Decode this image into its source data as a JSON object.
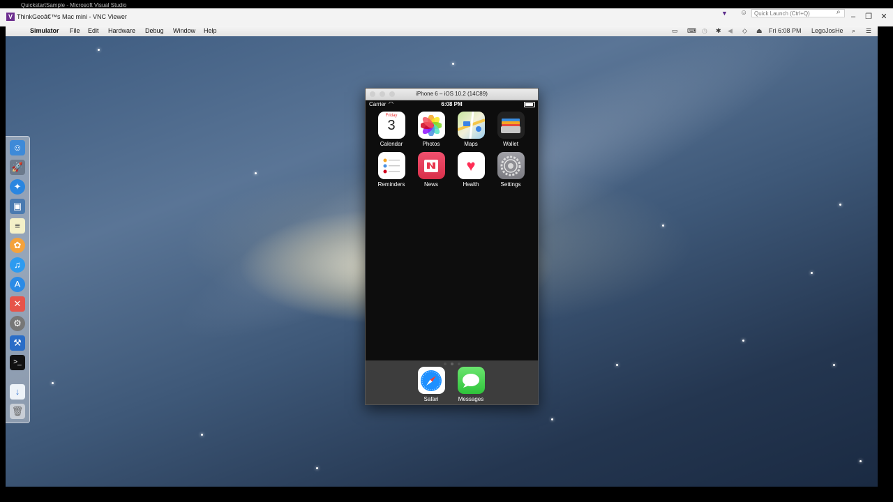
{
  "vnc": {
    "title": "ThinkGeoâ€™s Mac mini - VNC Viewer",
    "ghost_title": "QuickstartSample - Microsoft Visual Studio",
    "quick_launch_placeholder": "Quick Launch (Ctrl+Q)",
    "user": "LegoJosHe"
  },
  "menubar": {
    "app_name": "Simulator",
    "items": [
      "File",
      "Edit",
      "Hardware",
      "Debug",
      "Window",
      "Help"
    ],
    "clock": "Fri 6:08 PM",
    "user": "LegoJosHe"
  },
  "simulator": {
    "title": "iPhone 6 – iOS 10.2 (14C89)",
    "status": {
      "carrier": "Carrier",
      "time": "6:08 PM"
    },
    "calendar": {
      "day": "Friday",
      "date": "3"
    },
    "apps_row1": [
      "Calendar",
      "Photos",
      "Maps",
      "Wallet"
    ],
    "apps_row2": [
      "Reminders",
      "News",
      "Health",
      "Settings"
    ],
    "dock_apps": [
      "Safari",
      "Messages"
    ],
    "page_count": 3,
    "active_page": 2
  },
  "colors": {
    "accent_purple": "#6d2f8f",
    "news_red": "#e8364d",
    "messages_green": "#4cd964"
  }
}
